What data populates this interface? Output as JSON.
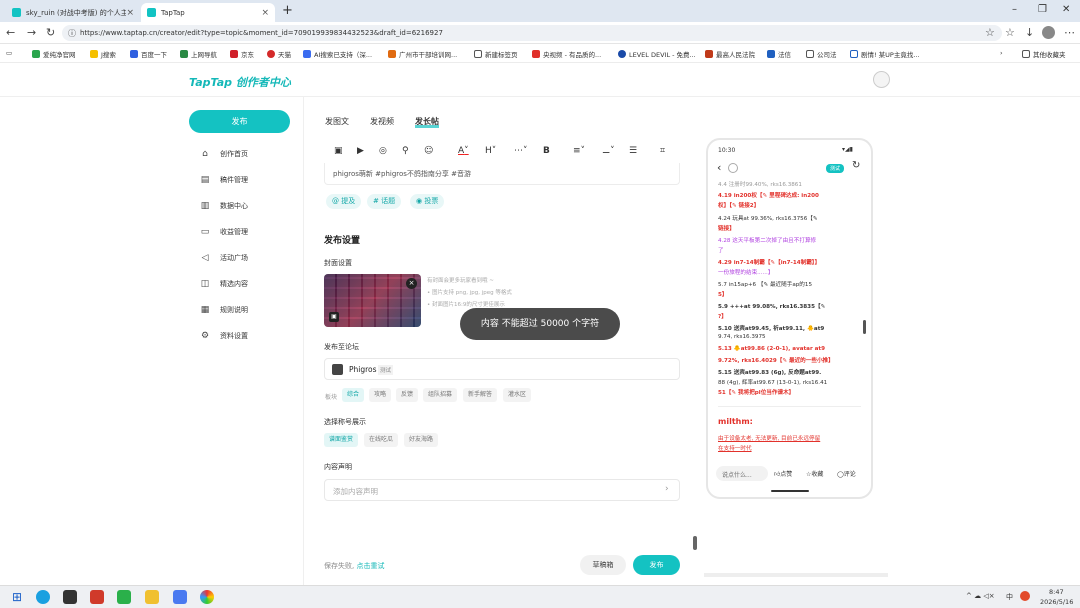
{
  "browser": {
    "tabs": [
      {
        "label": "sky_ruin (对战中考版) 的个人主页"
      },
      {
        "label": "TapTap"
      }
    ],
    "new_tab": "+",
    "url": "https://www.taptap.cn/creator/edit?type=topic&moment_id=709019939834432523&draft_id=6216927",
    "bookmarks": [
      "爱纯净官网",
      "J搜索",
      "百度一下",
      "上网导航",
      "京东",
      "天猫",
      "AI搜索已支持（深...",
      "广州市干部培训网...",
      "新建标签页",
      "央视频 - 有品质的...",
      "LEVEL DEVIL - 免费...",
      "最高人民法院",
      "法信",
      "公司法",
      "剧情! 某UP主竟找..."
    ],
    "other_bookmarks": "其他收藏夹"
  },
  "app": {
    "logo": "TapTap 创作者中心",
    "publish_button": "发布",
    "nav": [
      "创作首页",
      "稿件管理",
      "数据中心",
      "收益管理",
      "活动广场",
      "精选内容",
      "规则说明",
      "资料设置"
    ]
  },
  "editor": {
    "tabs": [
      "发图文",
      "发视频",
      "发长帖"
    ],
    "toolbar_text": [
      "A",
      "H",
      "B"
    ],
    "content_tail": "phigros萌新 #phigros不鸽指南分享 #音游",
    "tags": [
      "@ 提及",
      "# 话题",
      "投票"
    ]
  },
  "settings": {
    "title": "发布设置",
    "cover_label": "封面设置",
    "cover_hints": [
      "有封面会更多玩家看到哦 ~",
      "• 图片支持 png, jpg, jpeg 等格式",
      "• 封面图片16:9的尺寸更佳展示"
    ],
    "forum_label": "发布至论坛",
    "forum_name": "Phigros",
    "forum_badge": "测试",
    "board_label": "板块",
    "boards": [
      "综合",
      "攻略",
      "反馈",
      "组队招募",
      "新手解答",
      "灌水区"
    ],
    "title_label": "选择称号展示",
    "title_options": [
      "谱面鉴赏",
      "在线吃瓜",
      "好友海路"
    ],
    "declaration_label": "内容声明",
    "declaration_placeholder": "添加内容声明"
  },
  "toast": "内容 不能超过 50000 个字符",
  "footer": {
    "status": "保存失败, ",
    "retry": "点击重试",
    "draft": "草稿箱",
    "publish": "发布"
  },
  "preview": {
    "time": "10:30",
    "badge": "测试",
    "lines": [
      "4.4  注册时99.40%, rks16.3861",
      "4.19  in200权【✎ 里程碑达成: in200",
      "权】【✎ 链接2】",
      "4.24  玩具at 99.36%, rks16.3756【✎",
      "链接】",
      "4.28  这天平板第二次掉了由且不打算修",
      "了",
      "4.29  in7-14制霸【✎【in7-14制霸】】",
      "一份旅程的结束......】",
      "5.7  in15ap+6  【✎ 最近随手ap的15",
      "5】",
      "5.9  +++at 99.08%, rks16.3835【✎",
      "?】",
      "5.10  送宾at99.45, 祈at99.11, 🐥at9",
      "9.74, rks16.3975",
      "5.13  🐥at99.86 (2-0-1), avatar at9",
      "9.72%, rks16.4029【✎ 最近的一些小推】",
      "5.15  送宾at99.83 (6g), 反命题at99.",
      "88 (4g), 辉率at99.67 (13-0-1), rks16.41",
      "51【✎ 我将把pl位当作谱木】"
    ],
    "author": "milthm:",
    "note_lines": [
      "由于设备太老, 无法更新, 目前已永远停留",
      "在支持一时代"
    ],
    "comment_placeholder": "说点什么...",
    "actions": [
      "点赞",
      "收藏",
      "评论"
    ]
  },
  "taskbar": {
    "time": "8:47",
    "date": "2026/5/16",
    "ime": "中"
  }
}
